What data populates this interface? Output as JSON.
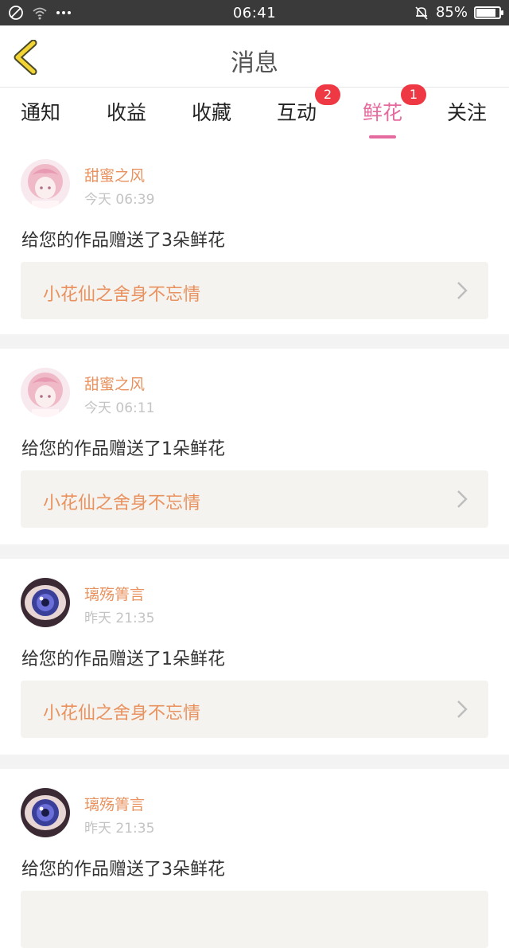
{
  "status_bar": {
    "time": "06:41",
    "battery": "85%",
    "battery_level": 0.85
  },
  "header": {
    "title": "消息"
  },
  "tabs": [
    {
      "label": "通知"
    },
    {
      "label": "收益"
    },
    {
      "label": "收藏"
    },
    {
      "label": "互动",
      "badge": "2"
    },
    {
      "label": "鲜花",
      "badge": "1",
      "active": true
    },
    {
      "label": "关注"
    }
  ],
  "messages": [
    {
      "user": "甜蜜之风",
      "time": "今天 06:39",
      "text": "给您的作品赠送了3朵鲜花",
      "work": "小花仙之舍身不忘情"
    },
    {
      "user": "甜蜜之风",
      "time": "今天 06:11",
      "text": "给您的作品赠送了1朵鲜花",
      "work": "小花仙之舍身不忘情"
    },
    {
      "user": "璃殇箐言",
      "time": "昨天 21:35",
      "text": "给您的作品赠送了1朵鲜花",
      "work": "小花仙之舍身不忘情"
    },
    {
      "user": "璃殇箐言",
      "time": "昨天 21:35",
      "text": "给您的作品赠送了3朵鲜花",
      "work": ""
    }
  ],
  "colors": {
    "accent": "#e56a9d",
    "name": "#e9925f",
    "badge": "#ee3844",
    "back_icon": "#f2d434"
  }
}
